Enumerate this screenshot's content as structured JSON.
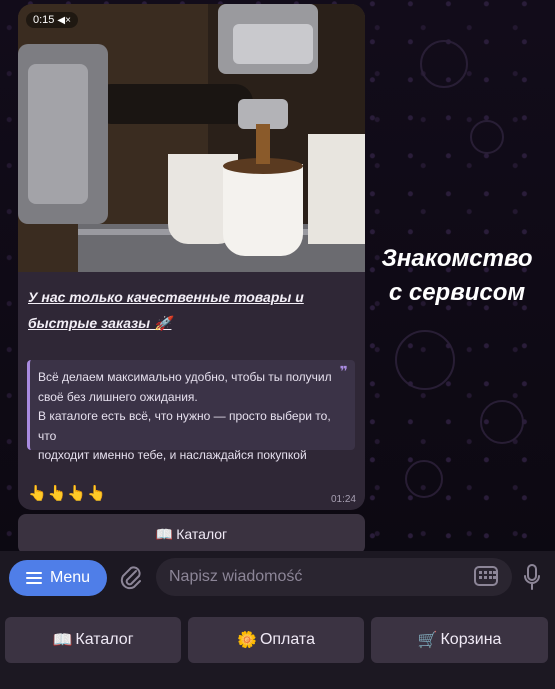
{
  "message": {
    "video_time": "0:15",
    "headline": "У нас только качественные товары и быстрые заказы 🚀",
    "quote_lines": [
      "Всё делаем максимально удобно, чтобы ты получил",
      "своё без лишнего ожидания.",
      "В каталоге есть всё, что нужно — просто выбери то, что",
      "подходит именно тебе, и наслаждайся покупкой"
    ],
    "hands": "👆👆👆👆",
    "sent_time": "01:24",
    "inline_button": {
      "emoji": "📖",
      "label": "Каталог"
    }
  },
  "caption": {
    "line1": "Знакомство",
    "line2": "с сервисом"
  },
  "input_bar": {
    "menu_label": "Menu",
    "placeholder": "Napisz wiadomość"
  },
  "keyboard": [
    {
      "emoji": "📖",
      "label": "Каталог"
    },
    {
      "emoji": "🌼",
      "label": "Оплата"
    },
    {
      "emoji": "🛒",
      "label": "Корзина"
    }
  ],
  "colors": {
    "accent": "#4f7ee8",
    "quote_bar": "#a98be0",
    "bubble": "#2f2736"
  }
}
